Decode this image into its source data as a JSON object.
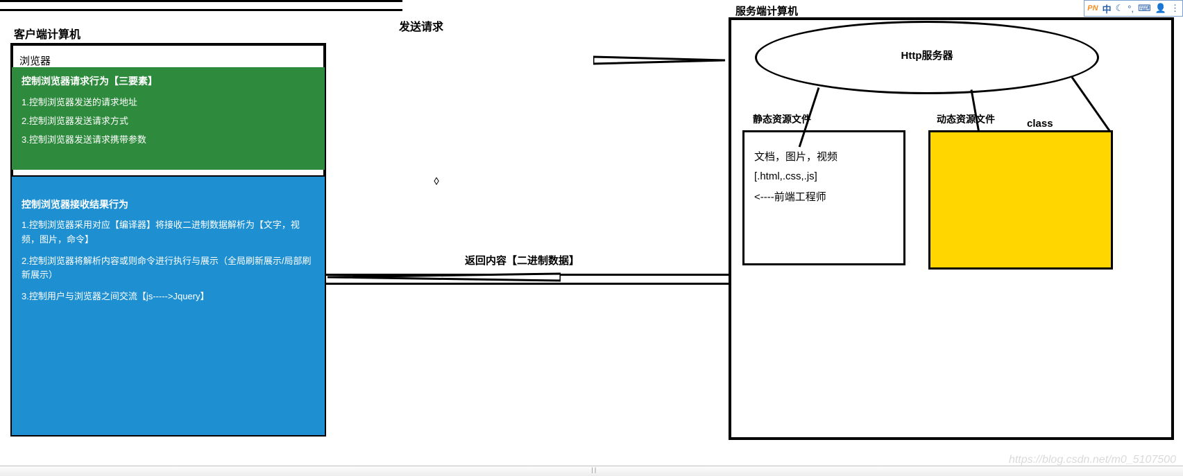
{
  "client": {
    "title": "客户端计算机",
    "browser_label": "浏览器",
    "green": {
      "header": "控制浏览器请求行为【三要素】",
      "l1": "1.控制浏览器发送的请求地址",
      "l2": "2.控制浏览器发送请求方式",
      "l3": "3.控制浏览器发送请求携带参数"
    },
    "blue": {
      "header": "控制浏览器接收结果行为",
      "l1": "1.控制浏览器采用对应【编译器】将接收二进制数据解析为【文字，视频，图片，命令】",
      "l2": "2.控制浏览器将解析内容或则命令进行执行与展示（全局刷新展示/局部刷新展示）",
      "l3": "3.控制用户与浏览器之间交流【js----->Jquery】"
    }
  },
  "arrows": {
    "request_label": "发送请求",
    "response_label": "返回内容【二进制数据】"
  },
  "server": {
    "title": "服务端计算机",
    "http_label": "Http服务器",
    "static_title": "静态资源文件",
    "dynamic_title": "动态资源文件",
    "class_label": "class",
    "static_box": {
      "l1": "文档，图片，视频",
      "l2": "[.html,.css,.js]",
      "l3": "<----前端工程师"
    }
  },
  "tray": {
    "brand": "PN",
    "lang": "中"
  },
  "watermark": "https://blog.csdn.net/m0_5107500"
}
